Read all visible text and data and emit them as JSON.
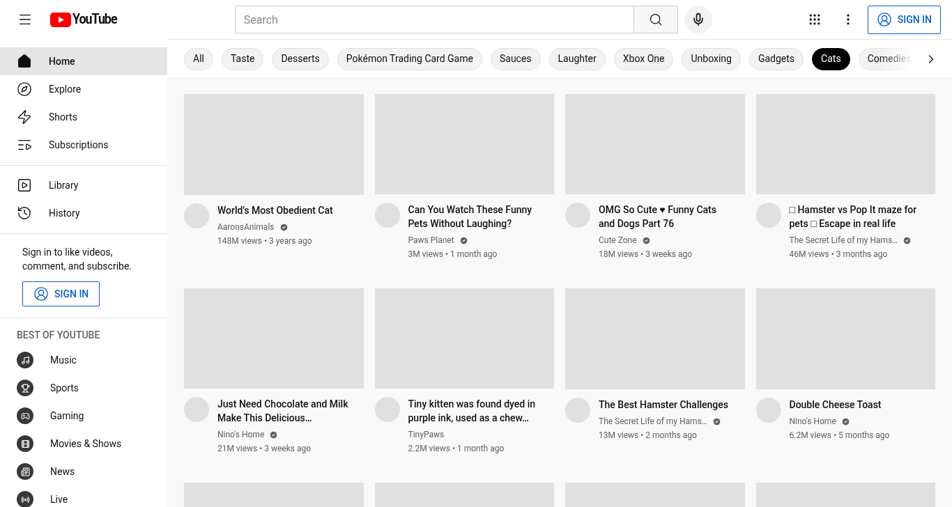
{
  "header": {
    "logo": "YouTube",
    "search": {
      "placeholder": "Search"
    },
    "sign_in": "SIGN IN"
  },
  "sidebar": {
    "sections": [
      {
        "items": [
          {
            "label": "Home",
            "selected": true
          },
          {
            "label": "Explore",
            "selected": false
          },
          {
            "label": "Shorts",
            "selected": false
          },
          {
            "label": "Subscriptions",
            "selected": false
          }
        ]
      },
      {
        "items": [
          {
            "label": "Library",
            "selected": false
          },
          {
            "label": "History",
            "selected": false
          }
        ]
      }
    ],
    "sign_in_prompt": {
      "text": "Sign in to like videos, comment, and subscribe.",
      "button": "SIGN IN"
    },
    "best_of": {
      "heading": "BEST OF YOUTUBE",
      "items": [
        {
          "label": "Music"
        },
        {
          "label": "Sports"
        },
        {
          "label": "Gaming"
        },
        {
          "label": "Movies & Shows"
        },
        {
          "label": "News"
        },
        {
          "label": "Live"
        }
      ]
    }
  },
  "chips": [
    {
      "label": "All",
      "selected": false
    },
    {
      "label": "Taste",
      "selected": false
    },
    {
      "label": "Desserts",
      "selected": false
    },
    {
      "label": "Pokémon Trading Card Game",
      "selected": false
    },
    {
      "label": "Sauces",
      "selected": false
    },
    {
      "label": "Laughter",
      "selected": false
    },
    {
      "label": "Xbox One",
      "selected": false
    },
    {
      "label": "Unboxing",
      "selected": false
    },
    {
      "label": "Gadgets",
      "selected": false
    },
    {
      "label": "Cats",
      "selected": true
    },
    {
      "label": "Comedies",
      "selected": false
    }
  ],
  "videos": [
    {
      "kind": "video",
      "title": "World's Most Obedient Cat",
      "channel": "AaronsAnimals",
      "verified": true,
      "meta": "148M views • 3 years ago"
    },
    {
      "kind": "video",
      "title": "Can You Watch These Funny Pets Without Laughing?",
      "channel": "Paws Planet",
      "verified": true,
      "meta": "3M views • 1 month ago"
    },
    {
      "kind": "video",
      "title": "OMG So Cute ♥ Funny Cats and Dogs Part 76",
      "channel": "Cute Zone",
      "verified": true,
      "meta": "18M views • 3 weeks ago"
    },
    {
      "kind": "video",
      "title": "□ Hamster vs Pop It maze for pets □ Escape in real life",
      "channel": "The Secret Life of my Hams…",
      "verified": true,
      "meta": "46M views • 3 months ago"
    },
    {
      "kind": "video",
      "title": "Just Need Chocolate and Milk Make This Delicious…",
      "channel": "Nino's Home",
      "verified": true,
      "meta": "21M views • 3 weeks ago"
    },
    {
      "kind": "video",
      "title": "Tiny kitten was found dyed in purple ink, used as a chew…",
      "channel": "TinyPaws",
      "verified": false,
      "meta": "2.2M views • 1 month ago"
    },
    {
      "kind": "video",
      "title": "The Best Hamster Challenges",
      "channel": "The Secret Life of my Hams…",
      "verified": true,
      "meta": "13M views • 2 months ago"
    },
    {
      "kind": "video",
      "title": "Double Cheese Toast",
      "channel": "Nino's Home",
      "verified": true,
      "meta": "6.2M views • 5 months ago"
    },
    {
      "kind": "loading"
    },
    {
      "kind": "loading"
    },
    {
      "kind": "loading"
    },
    {
      "kind": "loading"
    }
  ]
}
